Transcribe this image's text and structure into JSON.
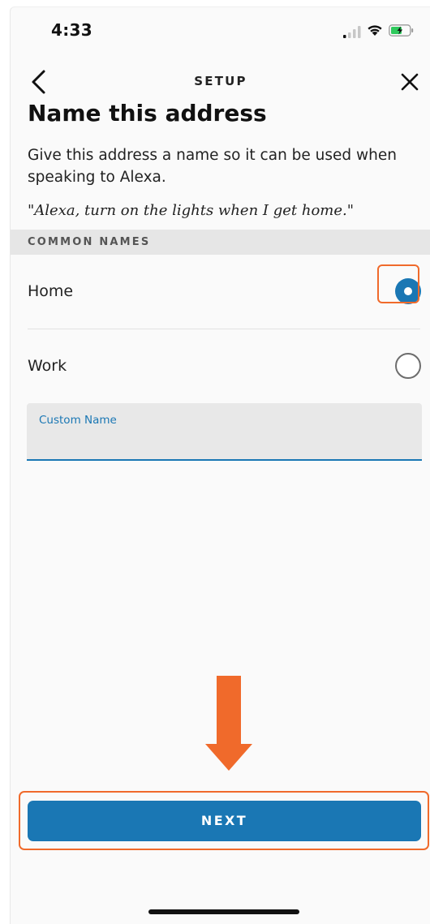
{
  "status_bar": {
    "time": "4:33",
    "icons": [
      "cellular-signal-icon",
      "wifi-icon",
      "battery-charging-icon"
    ]
  },
  "nav": {
    "title": "SETUP",
    "back_icon": "chevron-left-icon",
    "close_icon": "close-icon"
  },
  "page": {
    "title": "Name this address",
    "description": "Give this address a name so it can be used when speaking to Alexa.",
    "example": "\"Alexa, turn on the lights when I get home.\""
  },
  "common_names": {
    "header": "COMMON NAMES",
    "options": [
      {
        "label": "Home",
        "selected": true
      },
      {
        "label": "Work",
        "selected": false
      }
    ]
  },
  "custom_name": {
    "label": "Custom Name",
    "value": ""
  },
  "next_button": {
    "label": "NEXT"
  },
  "colors": {
    "accent": "#1a77b4",
    "annotation": "#f06a2b",
    "section_bg": "#e6e6e6"
  }
}
